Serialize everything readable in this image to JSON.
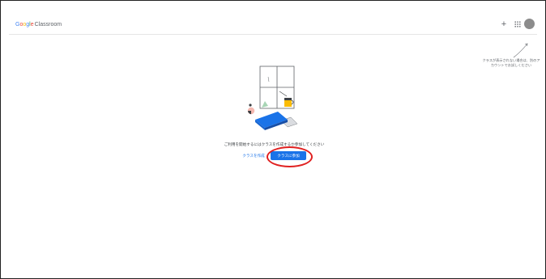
{
  "app": {
    "logo_letters": [
      "G",
      "o",
      "o",
      "g",
      "l",
      "e"
    ],
    "product_name": "Classroom"
  },
  "header": {
    "add_label": "+",
    "icons": {
      "add": "plus-icon",
      "apps": "apps-grid-icon",
      "account": "avatar"
    }
  },
  "hint": {
    "text": "クラスが表示されない場合は、別のアカウントでお試しください"
  },
  "main": {
    "message": "ご利用を開始するにはクラスを作成するか参加してください",
    "create_class_label": "クラスを作成",
    "join_class_label": "クラスに参加"
  },
  "colors": {
    "google_blue": "#4285f4",
    "google_red": "#ea4335",
    "google_yellow": "#fbbc05",
    "google_green": "#34a853",
    "primary_button": "#1a73e8",
    "annotation_circle": "#e02020"
  }
}
